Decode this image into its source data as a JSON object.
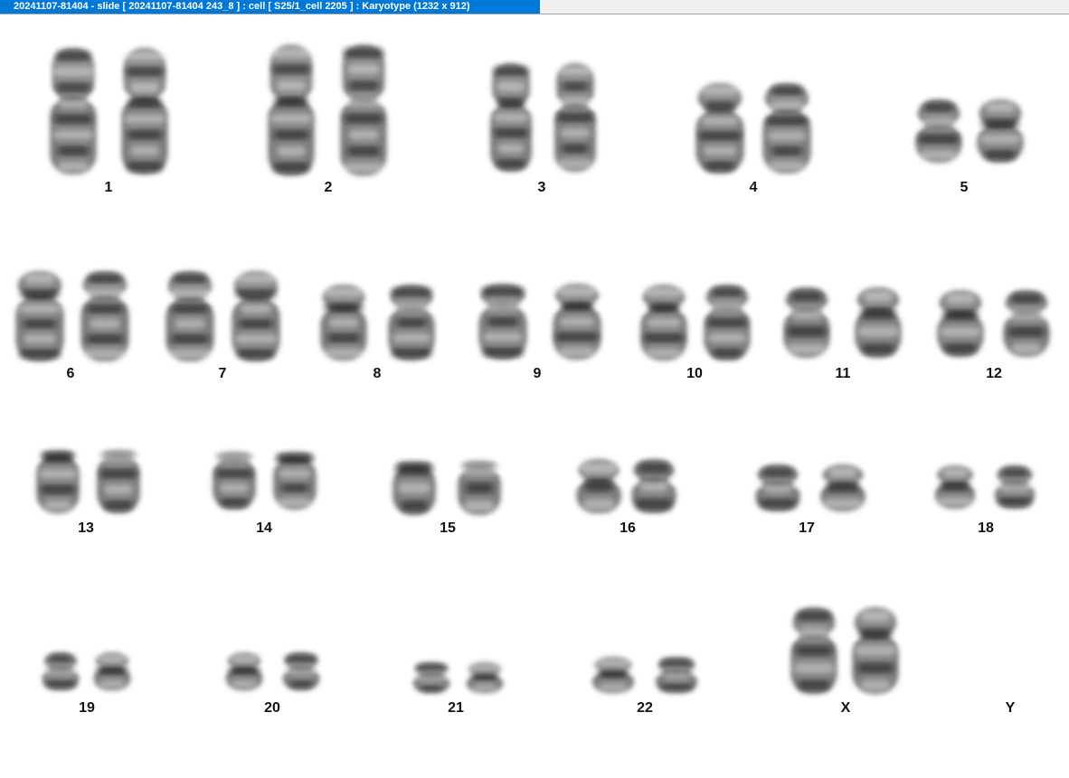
{
  "window": {
    "title": "20241107-81404 - slide [ 20241107-81404 243_8 ] : cell [ S25/1_cell 2205 ] : Karyotype  (1232 x 912)"
  },
  "colors": {
    "title_bar": "#0078d7",
    "title_text": "#ffffff",
    "background": "#ffffff",
    "chromatin": "#3a3a3a"
  },
  "karyotype": {
    "chromosomes": [
      {
        "label": "1",
        "count": 2
      },
      {
        "label": "2",
        "count": 2
      },
      {
        "label": "3",
        "count": 2
      },
      {
        "label": "4",
        "count": 2
      },
      {
        "label": "5",
        "count": 2
      },
      {
        "label": "6",
        "count": 2
      },
      {
        "label": "7",
        "count": 2
      },
      {
        "label": "8",
        "count": 2
      },
      {
        "label": "9",
        "count": 2
      },
      {
        "label": "10",
        "count": 2
      },
      {
        "label": "11",
        "count": 2
      },
      {
        "label": "12",
        "count": 2
      },
      {
        "label": "13",
        "count": 2
      },
      {
        "label": "14",
        "count": 2
      },
      {
        "label": "15",
        "count": 2
      },
      {
        "label": "16",
        "count": 2
      },
      {
        "label": "17",
        "count": 2
      },
      {
        "label": "18",
        "count": 2
      },
      {
        "label": "19",
        "count": 2
      },
      {
        "label": "20",
        "count": 2
      },
      {
        "label": "21",
        "count": 2
      },
      {
        "label": "22",
        "count": 2
      },
      {
        "label": "X",
        "count": 2
      },
      {
        "label": "Y",
        "count": 0
      }
    ]
  }
}
